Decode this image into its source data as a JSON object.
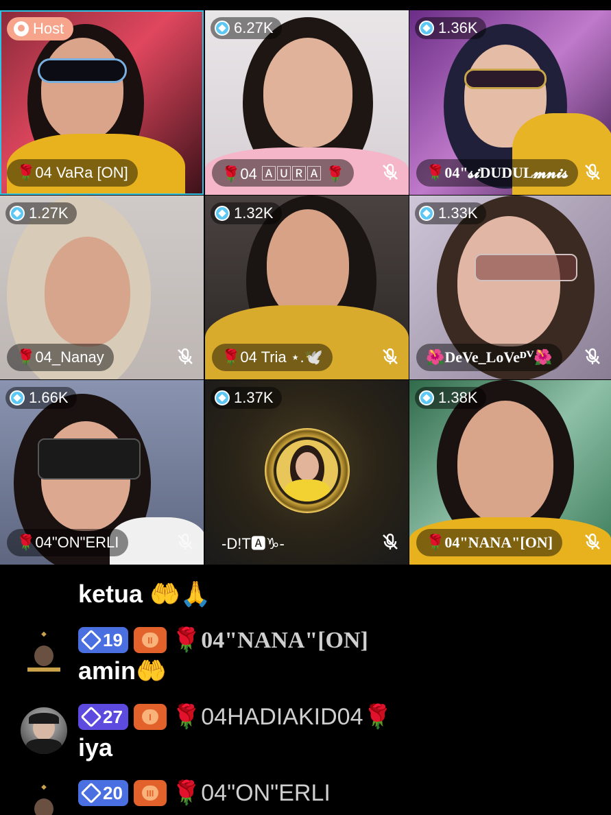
{
  "room": {
    "host_label": "Host",
    "tiles": [
      {
        "name": "🌹04 VaRa [ON]",
        "count": "",
        "is_host": true,
        "muted": false,
        "serif": false
      },
      {
        "name": "🌹04 🄰🅄🅁🄰 🌹",
        "count": "6.27K",
        "is_host": false,
        "muted": true,
        "serif": false
      },
      {
        "name": "🌹04\"𝓼𝓲DUDUL𝓶𝓷𝓲𝓼",
        "count": "1.36K",
        "is_host": false,
        "muted": true,
        "serif": true
      },
      {
        "name": "🌹04_Nanay",
        "count": "1.27K",
        "is_host": false,
        "muted": true,
        "serif": false
      },
      {
        "name": "🌹04 Tria ⋆.🕊️",
        "count": "1.32K",
        "is_host": false,
        "muted": true,
        "serif": false
      },
      {
        "name": "🌺DeVe_LoVeᴰⱽ🌺",
        "count": "1.33K",
        "is_host": false,
        "muted": true,
        "serif": true
      },
      {
        "name": "🌹04\"ON\"ERLI",
        "count": "1.66K",
        "is_host": false,
        "muted": true,
        "serif": false
      },
      {
        "name": "-D!T🅰♑-",
        "count": "1.37K",
        "is_host": false,
        "muted": true,
        "serif": false
      },
      {
        "name": "🌹04\"NANA\"[ON]",
        "count": "1.38K",
        "is_host": false,
        "muted": true,
        "serif": true
      }
    ]
  },
  "chat": {
    "partial_message": "ketua 🤲🙏",
    "messages": [
      {
        "level": "19",
        "fan_level": "II",
        "username": "🌹04\"NANA\"[ON]",
        "text": "amin🤲",
        "avatar": "family-badge-icon",
        "serif": true
      },
      {
        "level": "27",
        "fan_level": "I",
        "username": "🌹04HADIAKID04🌹",
        "text": "iya",
        "avatar": "user-avatar",
        "serif": false
      },
      {
        "level": "20",
        "fan_level": "III",
        "username": "🌹04\"ON\"ERLI",
        "text": "",
        "avatar": "family-badge-icon",
        "serif": false
      }
    ]
  },
  "colors": {
    "host_pill": "#f6a58c",
    "host_border": "#2fc3e8",
    "level_badge": "#4a6fe0",
    "fan_badge": "#e3622c"
  }
}
